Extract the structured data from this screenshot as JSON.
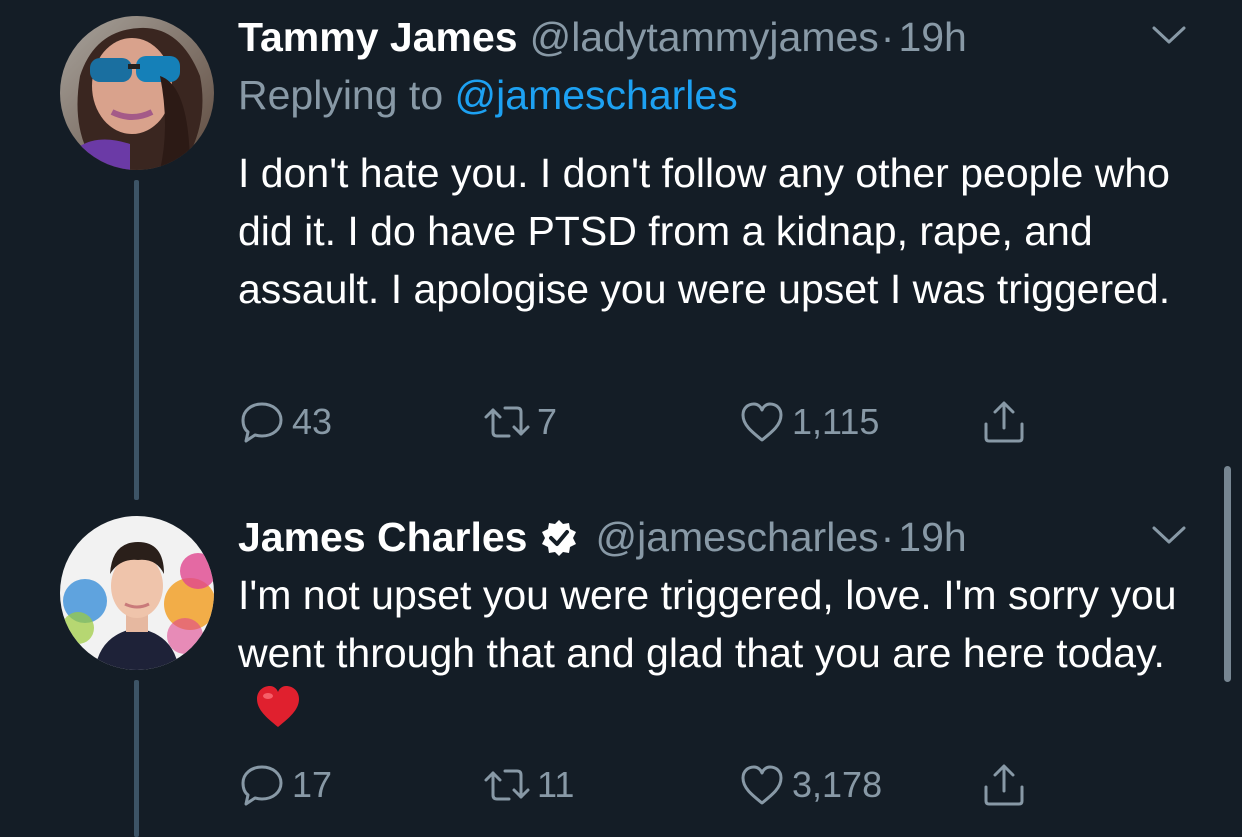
{
  "tweets": [
    {
      "name": "Tammy James",
      "handle": "@ladytammyjames",
      "separator": "·",
      "time": "19h",
      "replying_prefix": "Replying to",
      "replying_mention": "@jamescharles",
      "text": "I don't hate you. I don't follow any other people who did it. I do have PTSD from a kidnap, rape, and assault. I apologise you were upset I was triggered.",
      "replies": "43",
      "retweets": "7",
      "likes": "1,115"
    },
    {
      "name": "James Charles",
      "handle": "@jamescharles",
      "separator": "·",
      "time": "19h",
      "verified": true,
      "text": "I'm not upset you were triggered, love. I'm sorry you went through that and glad that you are here today.",
      "emoji": "red-heart",
      "replies": "17",
      "retweets": "11",
      "likes": "3,178"
    }
  ],
  "colors": {
    "background": "#141d26",
    "secondary_text": "#8899a6",
    "link": "#1da1f2",
    "thread_line": "#3d5466"
  }
}
